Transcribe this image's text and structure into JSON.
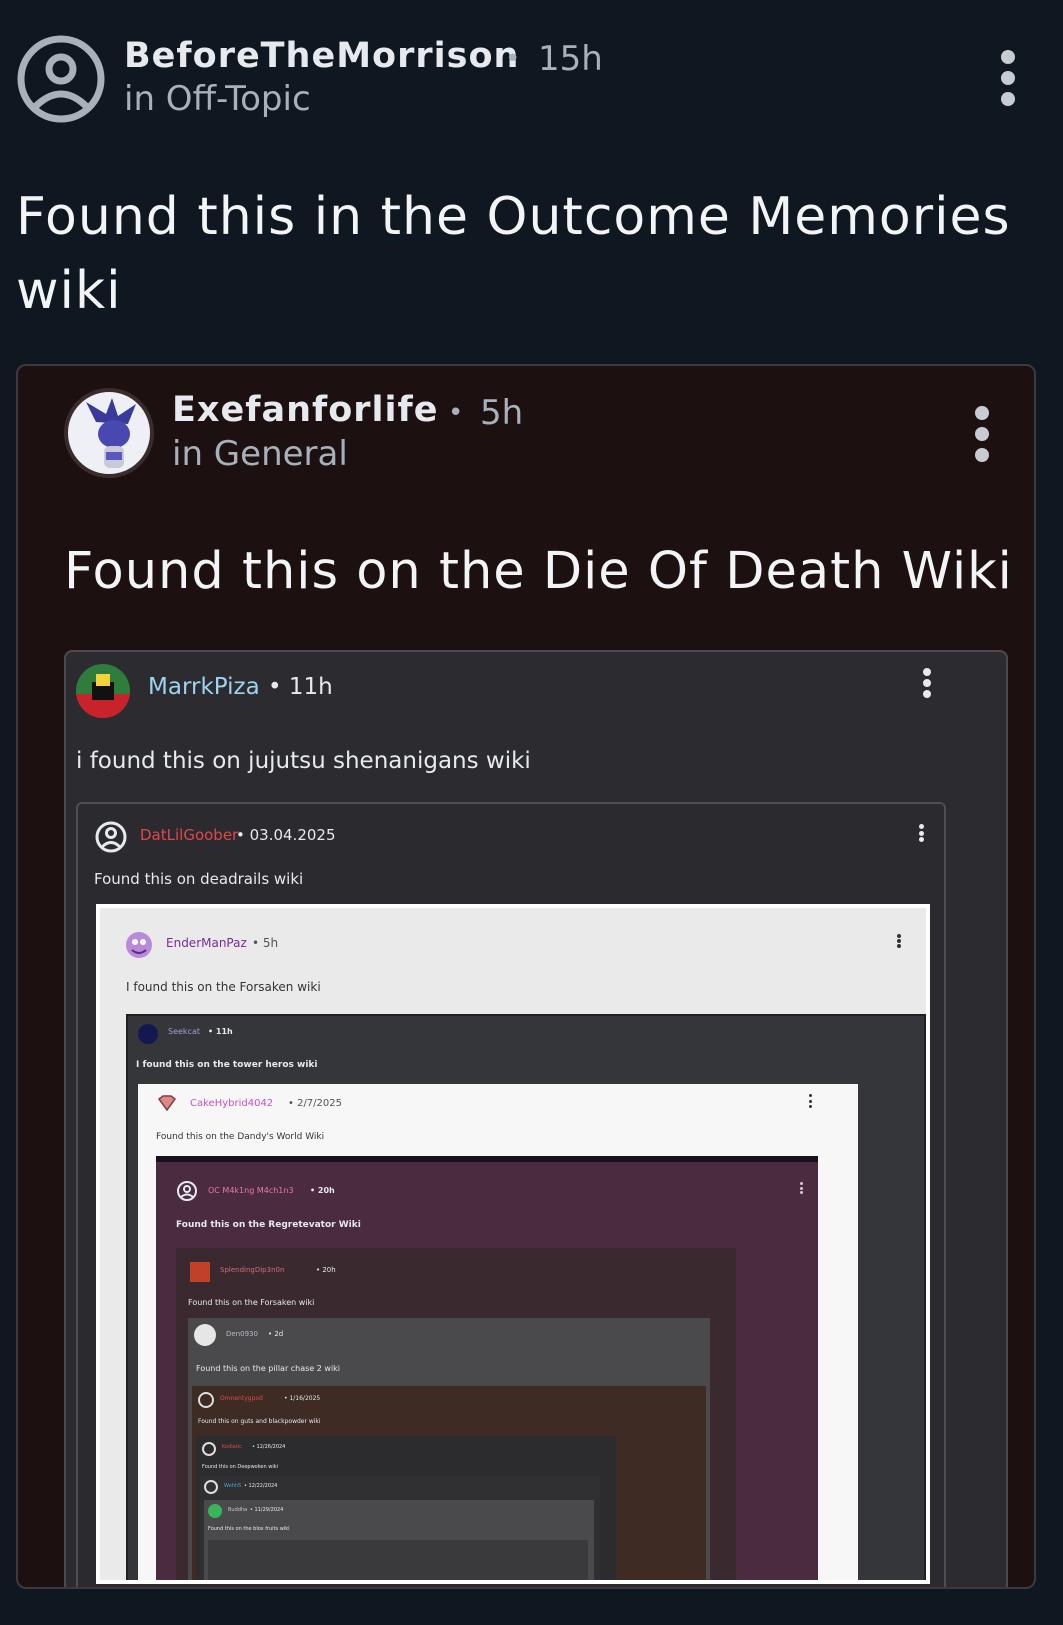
{
  "colors": {
    "page_bg": "#0f1720",
    "card_bg": "#1d1011",
    "text_main": "#e6e9ee",
    "text_muted": "#a8b0ba",
    "link_blue": "#9ed3f0",
    "link_red": "#e0474c",
    "link_pink": "#c850c8"
  },
  "post": {
    "author": "BeforeTheMorrison",
    "dot": "•",
    "age": "15h",
    "community": "in Off-Topic",
    "title": "Found this in the Outcome Memories wiki",
    "avatar_icon": "user-circle-icon",
    "menu_icon": "more-vertical-icon"
  },
  "embed1": {
    "author": "Exefanforlife",
    "dot": "•",
    "age": "5h",
    "community": "in General",
    "title": "Found this on the Die Of Death Wiki",
    "avatar_icon": "character-avatar-icon",
    "menu_icon": "more-vertical-icon"
  },
  "embed2": {
    "author": "MarrkPiza",
    "meta": "• 11h",
    "text": "i found this on jujutsu shenanigans wiki",
    "avatar_icon": "roblox-avatar-icon"
  },
  "embed3": {
    "author": "DatLilGoober",
    "meta": "• 03.04.2025",
    "text": "Found this on deadrails wiki",
    "avatar_icon": "user-circle-icon"
  },
  "embed4": {
    "author": "EnderManPaz",
    "meta": "• 5h",
    "text": "I found this on the Forsaken wiki",
    "avatar_icon": "character-avatar-icon"
  },
  "embed5": {
    "author": "Seekcat",
    "meta": "• 11h",
    "text": "I found this on the tower heros wiki"
  },
  "embed6": {
    "author": "CakeHybrid4042",
    "meta": "• 2/7/2025",
    "text": "Found this on the Dandy's World Wiki"
  },
  "embed7": {
    "author": "OC M4k1ng M4ch1n3",
    "meta": "• 20h",
    "text": "Found this on the Regretevator Wiki"
  },
  "embed8": {
    "author": "SplendingDip3n0n",
    "meta": "• 20h",
    "text": "Found this on the Forsaken wiki"
  },
  "embed9": {
    "author": "Den0930",
    "meta": "• 2d",
    "text": "Found this on the pillar chase 2 wiki"
  },
  "embed10": {
    "author": "Omnentygpod",
    "meta": "• 1/16/2025",
    "text": "Found this on guts and blackpowder wiki"
  },
  "embed11": {
    "author": "Kodiatic",
    "meta": "• 12/26/2024",
    "text": "Found this on Deepwoken wiki"
  },
  "embed12": {
    "author": "Wehh5",
    "meta": "• 12/22/2024"
  },
  "embed13": {
    "author": "Buddha",
    "meta": "• 11/29/2024",
    "text": "Found this on the blox fruits wiki"
  }
}
